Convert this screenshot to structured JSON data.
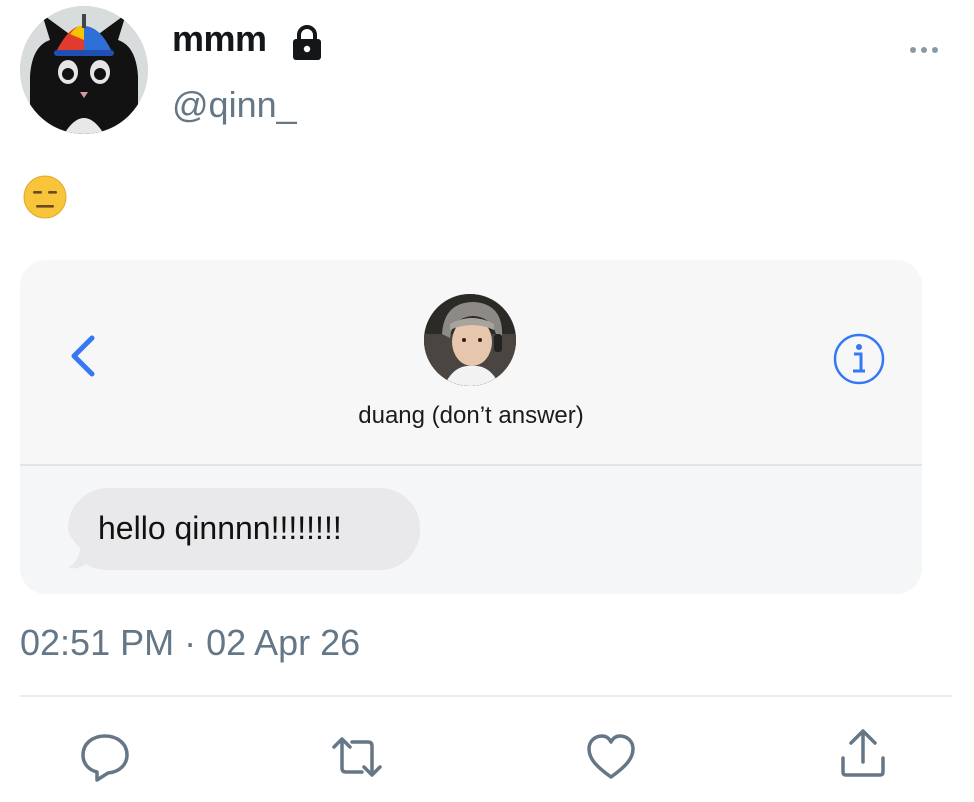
{
  "tweet": {
    "author": {
      "display_name": "mmm",
      "handle": "@qinn_",
      "protected_icon": "lock-icon",
      "avatar": "cat-with-propeller-cap"
    },
    "text_emoji": "expressionless-face-emoji",
    "timestamp": "02:51 PM · 02 Apr 26",
    "more_icon": "ellipsis-icon"
  },
  "embedded_screenshot": {
    "contact_name": "duang (don’t answer)",
    "back_icon": "chevron-left-icon",
    "info_icon": "info-circle-icon",
    "message": {
      "text": "hello qinnnn!!!!!!!!"
    },
    "accent_color": "#3478f6",
    "bubble_color": "#e9e9eb"
  },
  "actions": [
    {
      "name": "reply",
      "icon": "reply-icon"
    },
    {
      "name": "retweet",
      "icon": "retweet-icon"
    },
    {
      "name": "like",
      "icon": "heart-icon"
    },
    {
      "name": "share",
      "icon": "share-icon"
    }
  ],
  "colors": {
    "secondary_text": "#657786",
    "icon": "#657786",
    "primary_text": "#14171a"
  }
}
